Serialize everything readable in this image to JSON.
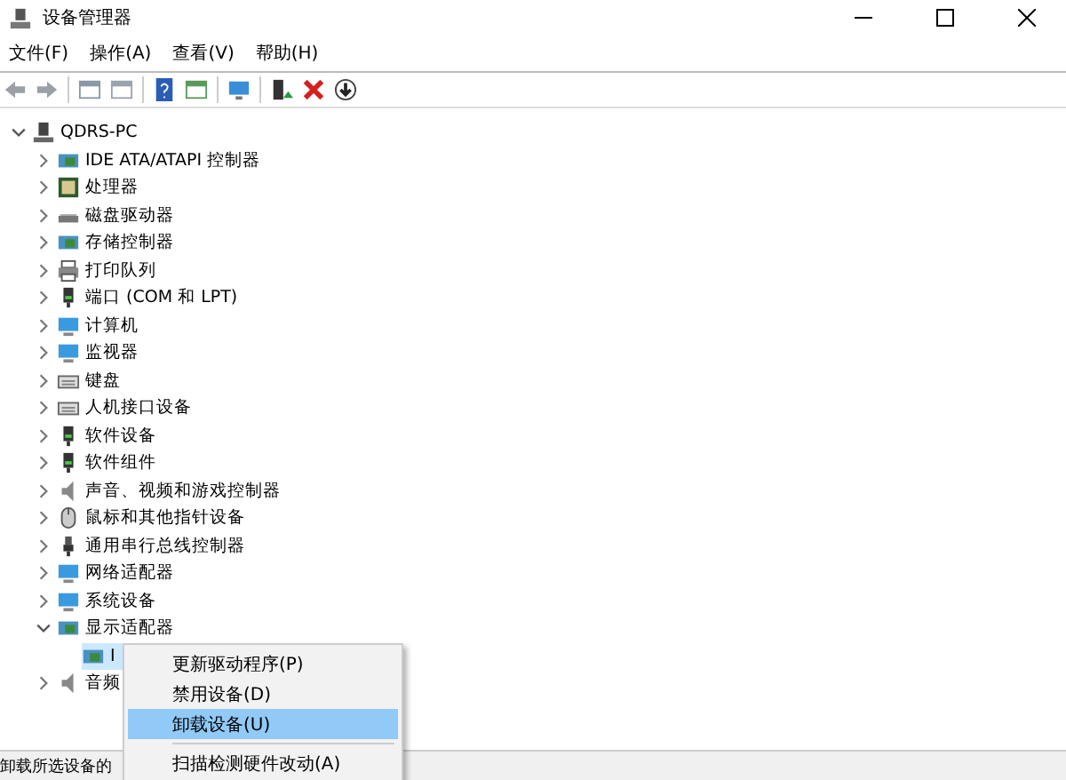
{
  "window": {
    "title": "设备管理器"
  },
  "menu_bar": [
    "文件(F)",
    "操作(A)",
    "查看(V)",
    "帮助(H)"
  ],
  "tree": {
    "label": "QDRS-PC",
    "expanded": true,
    "children": [
      {
        "label": "IDE ATA/ATAPI 控制器",
        "expanded": false
      },
      {
        "label": "处理器",
        "expanded": false
      },
      {
        "label": "磁盘驱动器",
        "expanded": false
      },
      {
        "label": "存储控制器",
        "expanded": false
      },
      {
        "label": "打印队列",
        "expanded": false
      },
      {
        "label": "端口 (COM 和 LPT)",
        "expanded": false
      },
      {
        "label": "计算机",
        "expanded": false
      },
      {
        "label": "监视器",
        "expanded": false
      },
      {
        "label": "键盘",
        "expanded": false
      },
      {
        "label": "人机接口设备",
        "expanded": false
      },
      {
        "label": "软件设备",
        "expanded": false
      },
      {
        "label": "软件组件",
        "expanded": false
      },
      {
        "label": "声音、视频和游戏控制器",
        "expanded": false
      },
      {
        "label": "鼠标和其他指针设备",
        "expanded": false
      },
      {
        "label": "通用串行总线控制器",
        "expanded": false
      },
      {
        "label": "网络适配器",
        "expanded": false
      },
      {
        "label": "系统设备",
        "expanded": false
      },
      {
        "label": "显示适配器",
        "expanded": true,
        "children": [
          {
            "label": "I",
            "selected": true
          }
        ]
      },
      {
        "label": "音频",
        "expanded": false
      }
    ]
  },
  "context_menu": [
    {
      "kind": "item",
      "label": "更新驱动程序(P)",
      "selected": false
    },
    {
      "kind": "item",
      "label": "禁用设备(D)",
      "selected": false
    },
    {
      "kind": "item",
      "label": "卸载设备(U)",
      "selected": true
    },
    {
      "kind": "separator"
    },
    {
      "kind": "item",
      "label": "扫描检测硬件改动(A)",
      "selected": false
    }
  ],
  "status_bar": "卸载所选设备的"
}
